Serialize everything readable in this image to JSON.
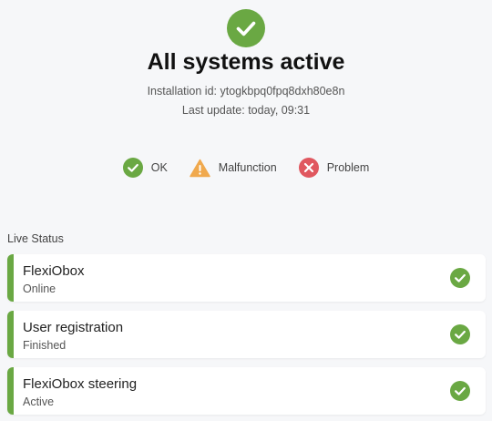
{
  "colors": {
    "ok": "#6aa843",
    "malfunction": "#f0a94e",
    "problem": "#e0575f",
    "background": "#f6f7f9",
    "card": "#ffffff"
  },
  "header": {
    "icon": "check-circle-icon",
    "title": "All systems active",
    "installation_id": "Installation id: ytogkbpq0fpq8dxh80e8n",
    "last_update": "Last update: today, 09:31"
  },
  "legend": [
    {
      "label": "OK",
      "icon": "check-circle-icon"
    },
    {
      "label": "Malfunction",
      "icon": "warning-triangle-icon"
    },
    {
      "label": "Problem",
      "icon": "x-circle-icon"
    }
  ],
  "live_status": {
    "label": "Live Status",
    "items": [
      {
        "title": "FlexiObox",
        "status": "Online",
        "state_icon": "check-circle-icon"
      },
      {
        "title": "User registration",
        "status": "Finished",
        "state_icon": "check-circle-icon"
      },
      {
        "title": "FlexiObox steering",
        "status": "Active",
        "state_icon": "check-circle-icon"
      }
    ]
  }
}
